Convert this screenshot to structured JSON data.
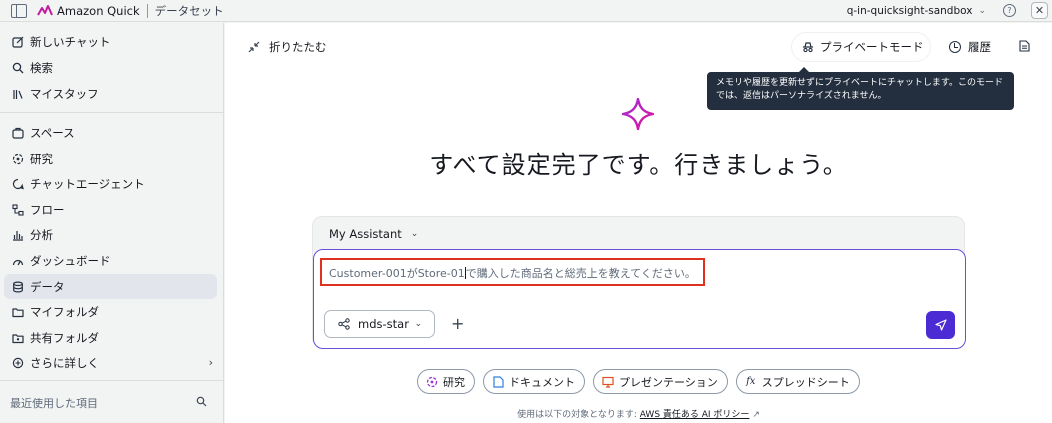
{
  "topbar": {
    "app_title": "Amazon Quick",
    "breadcrumb": "データセット",
    "account": "q-in-quicksight-sandbox",
    "help_icon": "?",
    "close_icon": "✕"
  },
  "sidebar": {
    "items": [
      {
        "label": "新しいチャット",
        "icon": "compose-icon"
      },
      {
        "label": "検索",
        "icon": "search-icon"
      },
      {
        "label": "マイスタッフ",
        "icon": "library-icon"
      },
      {
        "label": "スペース",
        "icon": "spaces-icon"
      },
      {
        "label": "研究",
        "icon": "research-icon"
      },
      {
        "label": "チャットエージェント",
        "icon": "chat-agent-icon"
      },
      {
        "label": "フロー",
        "icon": "flow-icon"
      },
      {
        "label": "分析",
        "icon": "analysis-icon"
      },
      {
        "label": "ダッシュボード",
        "icon": "dashboard-icon"
      },
      {
        "label": "データ",
        "icon": "database-icon",
        "active": true
      },
      {
        "label": "マイフォルダ",
        "icon": "folder-icon"
      },
      {
        "label": "共有フォルダ",
        "icon": "shared-folder-icon"
      },
      {
        "label": "さらに詳しく",
        "icon": "more-icon"
      }
    ],
    "recent_label": "最近使用した項目"
  },
  "main": {
    "collapse_label": "折りたたむ",
    "private_mode_label": "プライベートモード",
    "history_label": "履歴",
    "tooltip": "メモリや履歴を更新せずにプライベートにチャットします。このモードでは、返信はパーソナライズされません。",
    "hero": "すべて設定完了です。行きましょう。",
    "assistant_label": "My Assistant",
    "query_before_caret": "Customer-001がStore-01",
    "query_after_caret": "で購入した商品名と総売上を教えてください。",
    "knowledge_base": "mds-star",
    "chips": [
      {
        "label": "研究",
        "icon": "research-icon"
      },
      {
        "label": "ドキュメント",
        "icon": "document-icon"
      },
      {
        "label": "プレゼンテーション",
        "icon": "presentation-icon"
      },
      {
        "label": "スプレッドシート",
        "icon": "spreadsheet-icon"
      }
    ],
    "footer_text": "使用は以下の対象となります:",
    "footer_link": "AWS 責任ある AI ポリシー"
  },
  "colors": {
    "accent": "#4b2bd4",
    "highlight_border": "#e0301e",
    "tooltip_bg": "#232f3e"
  }
}
